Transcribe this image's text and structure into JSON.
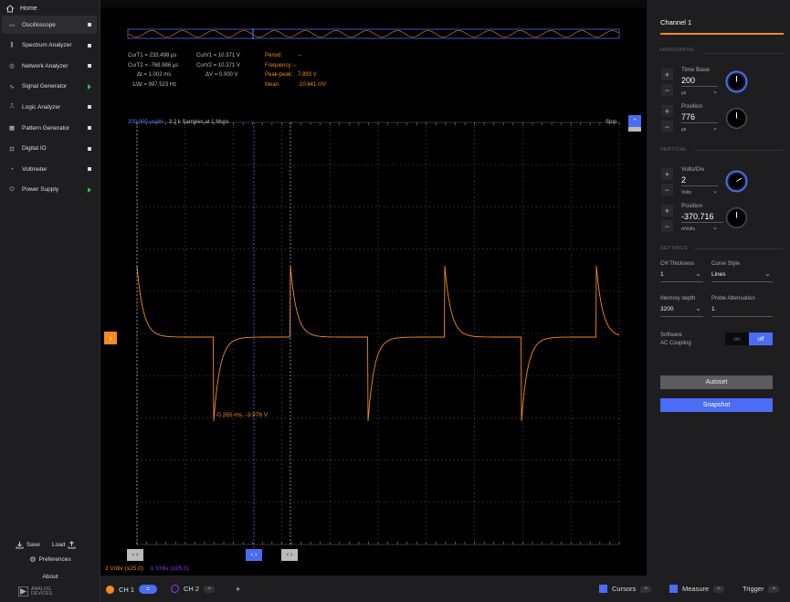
{
  "sidebar": {
    "home": "Home",
    "items": [
      {
        "label": "Oscilloscope",
        "status": "stopped"
      },
      {
        "label": "Spectrum Analyzer",
        "status": "stopped"
      },
      {
        "label": "Network Analyzer",
        "status": "stopped"
      },
      {
        "label": "Signal Generator",
        "status": "running"
      },
      {
        "label": "Logic Analyzer",
        "status": "stopped"
      },
      {
        "label": "Pattern Generator",
        "status": "stopped"
      },
      {
        "label": "Digital IO",
        "status": "stopped"
      },
      {
        "label": "Voltmeter",
        "status": "stopped"
      },
      {
        "label": "Power Supply",
        "status": "running"
      }
    ],
    "save": "Save",
    "load": "Load",
    "preferences": "Preferences",
    "about": "About",
    "brand": "ANALOG DEVICES"
  },
  "cursors": {
    "t1": "CurT1 = 233.498 µs",
    "t2": "CurT2 = -768.986 µs",
    "dt": "Δt = 1.002 ms",
    "inv_dt": "1/Δt = 997.523 Hz",
    "v1": "CurV1 = 10.371 V",
    "v2": "CurV2 = 10.371 V",
    "dv": "ΔV = 0.000 V"
  },
  "measure": {
    "period_label": "Period:",
    "period": "--",
    "freq_label": "Frequency:",
    "freq": "--",
    "pp_label": "Peak-peak:",
    "pp": "7.893 V",
    "mean_label": "Mean:",
    "mean": "-10.641 mV"
  },
  "plot": {
    "timebase": "200.000 µs/div",
    "samples": "3.2 k Samples at 1 Msps",
    "state": "Stop",
    "annotation": "-0.265 ms, -3.976 V",
    "ch1_scale": "2 V/div (x25.0)",
    "ch2_scale": "1 V/div (x25.0)",
    "marker": "›"
  },
  "panel": {
    "title": "Channel 1",
    "horizontal": "HORIZONTAL",
    "time_base_label": "Time Base",
    "time_base": "200",
    "time_base_unit": "µs",
    "h_pos_label": "Position",
    "h_pos": "776",
    "h_pos_unit": "µs",
    "vertical": "VERTICAL",
    "volts_label": "Volts/Div",
    "volts": "2",
    "volts_unit": "Volts",
    "v_pos_label": "Position",
    "v_pos": "-370.716",
    "v_pos_unit": "mVolts",
    "settings": "SETTINGS",
    "thickness_label": "CH Thickness",
    "thickness": "1",
    "curve_label": "Curve Style",
    "curve": "Lines",
    "memory_label": "Memory depth",
    "memory": "3200",
    "probe_label": "Probe Attenuation",
    "probe": "1",
    "coupling_label1": "Software",
    "coupling_label2": "AC Coupling",
    "on": "on",
    "off": "off",
    "autoset": "Autoset",
    "snapshot": "Snapshot"
  },
  "bottom": {
    "ch1": "CH 1",
    "ch2": "CH 2",
    "add": "+",
    "cursors": "Cursors",
    "measure": "Measure",
    "trigger": "Trigger"
  },
  "colors": {
    "ch1": "#f58a1d",
    "ch2": "#9b30ff",
    "accent": "#4b6cf5",
    "running": "#2dbd4a"
  },
  "icons": [
    "home-icon",
    "oscilloscope-icon",
    "spectrum-icon",
    "network-icon",
    "signal-icon",
    "logic-icon",
    "pattern-icon",
    "digital-io-icon",
    "voltmeter-icon",
    "power-icon",
    "save-icon",
    "load-icon",
    "gear-icon",
    "adi-logo-icon"
  ]
}
